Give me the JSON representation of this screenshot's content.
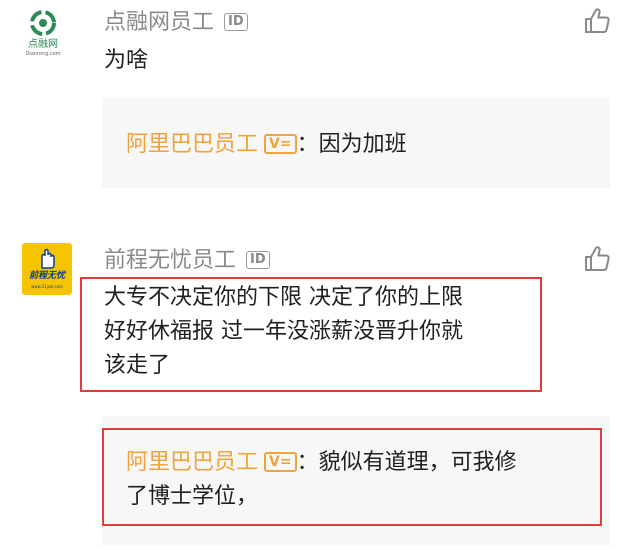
{
  "comments": [
    {
      "avatar": {
        "name": "点融网",
        "sub": "Dianrong.com",
        "icon": "dianrong-logo-icon"
      },
      "author": "点融网员工",
      "badge": "ID",
      "text": [
        "为啥"
      ],
      "reply": {
        "author": "阿里巴巴员工",
        "badge": "V=",
        "separator": "：",
        "lines": [
          "因为加班"
        ]
      }
    },
    {
      "avatar": {
        "name": "前程无忧",
        "sub": "www.51job.com",
        "icon": "51job-hand-logo-icon"
      },
      "author": "前程无忧员工",
      "badge": "ID",
      "text": [
        "大专不决定你的下限   决定了你的上限",
        "好好休福报    过一年没涨薪没晋升你就",
        "该走了"
      ],
      "reply": {
        "author": "阿里巴巴员工",
        "badge": "V=",
        "separator": "：",
        "lines": [
          "貌似有道理，可我修",
          "了博士学位，"
        ]
      }
    }
  ],
  "colors": {
    "accent": "#f0a23c",
    "highlight_box": "#e43b3b",
    "reply_bg": "#f7f7f7"
  },
  "icons": [
    "like-icon",
    "id-badge-icon",
    "verified-badge-icon"
  ]
}
